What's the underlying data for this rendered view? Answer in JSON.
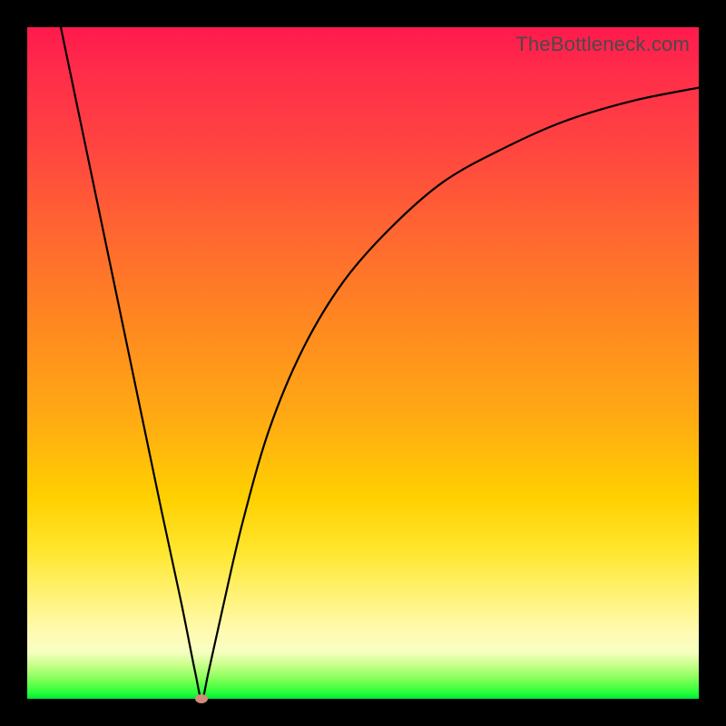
{
  "watermark": "TheBottleneck.com",
  "colors": {
    "top": "#ff1a4d",
    "mid1": "#ff6a2f",
    "mid2": "#ffd000",
    "low": "#fff37a",
    "green": "#00e83a",
    "frame": "#000000",
    "curve": "#000000",
    "marker": "#d28a7a"
  },
  "chart_data": {
    "type": "line",
    "title": "",
    "xlabel": "",
    "ylabel": "",
    "xlim": [
      0,
      100
    ],
    "ylim": [
      0,
      100
    ],
    "grid": false,
    "legend": false,
    "min_point": {
      "x": 26,
      "y": 0
    },
    "marker": {
      "x": 26,
      "y": 0
    },
    "series": [
      {
        "name": "curve",
        "x": [
          5,
          10,
          15,
          20,
          23,
          25,
          26,
          27,
          29,
          32,
          36,
          41,
          47,
          54,
          62,
          71,
          80,
          90,
          100
        ],
        "y": [
          100,
          76,
          52,
          28,
          14,
          4,
          0,
          4,
          13,
          26,
          40,
          52,
          62,
          70,
          77,
          82,
          86,
          89,
          91
        ]
      }
    ]
  }
}
